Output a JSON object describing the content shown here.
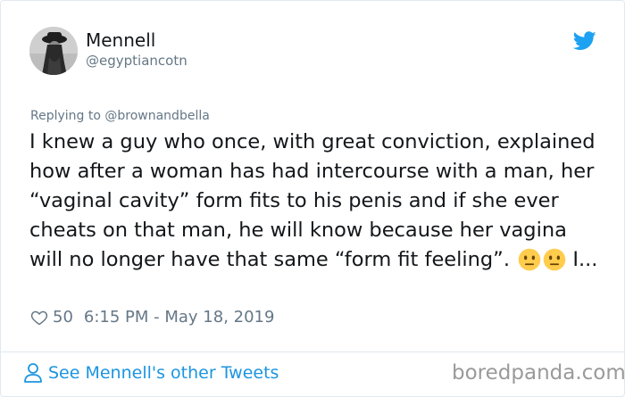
{
  "tweet": {
    "author": {
      "display_name": "Mennell",
      "handle": "@egyptiancotn"
    },
    "reply_context": "Replying to @brownandbella",
    "text": "I knew a guy who once, with great conviction, explained how after a woman has had intercourse with a man, her “vaginal cavity” form fits to his penis and if she ever cheats on that man, he will know because her vagina will no longer have that same “form fit feeling”.",
    "text_tail": "I...",
    "emojis": [
      "neutral-face-emoji",
      "neutral-face-emoji"
    ],
    "likes": "50",
    "timestamp": "6:15 PM - May 18, 2019"
  },
  "footer": {
    "see_more_label": "See Mennell's other Tweets"
  },
  "watermark": "boredpanda.com",
  "colors": {
    "twitter_blue": "#1da1f2",
    "link_blue": "#1b95e0",
    "secondary_text": "#657786",
    "emoji_yellow": "#ffcc4d"
  },
  "icons": [
    "twitter-bird-icon",
    "heart-icon",
    "person-icon"
  ]
}
